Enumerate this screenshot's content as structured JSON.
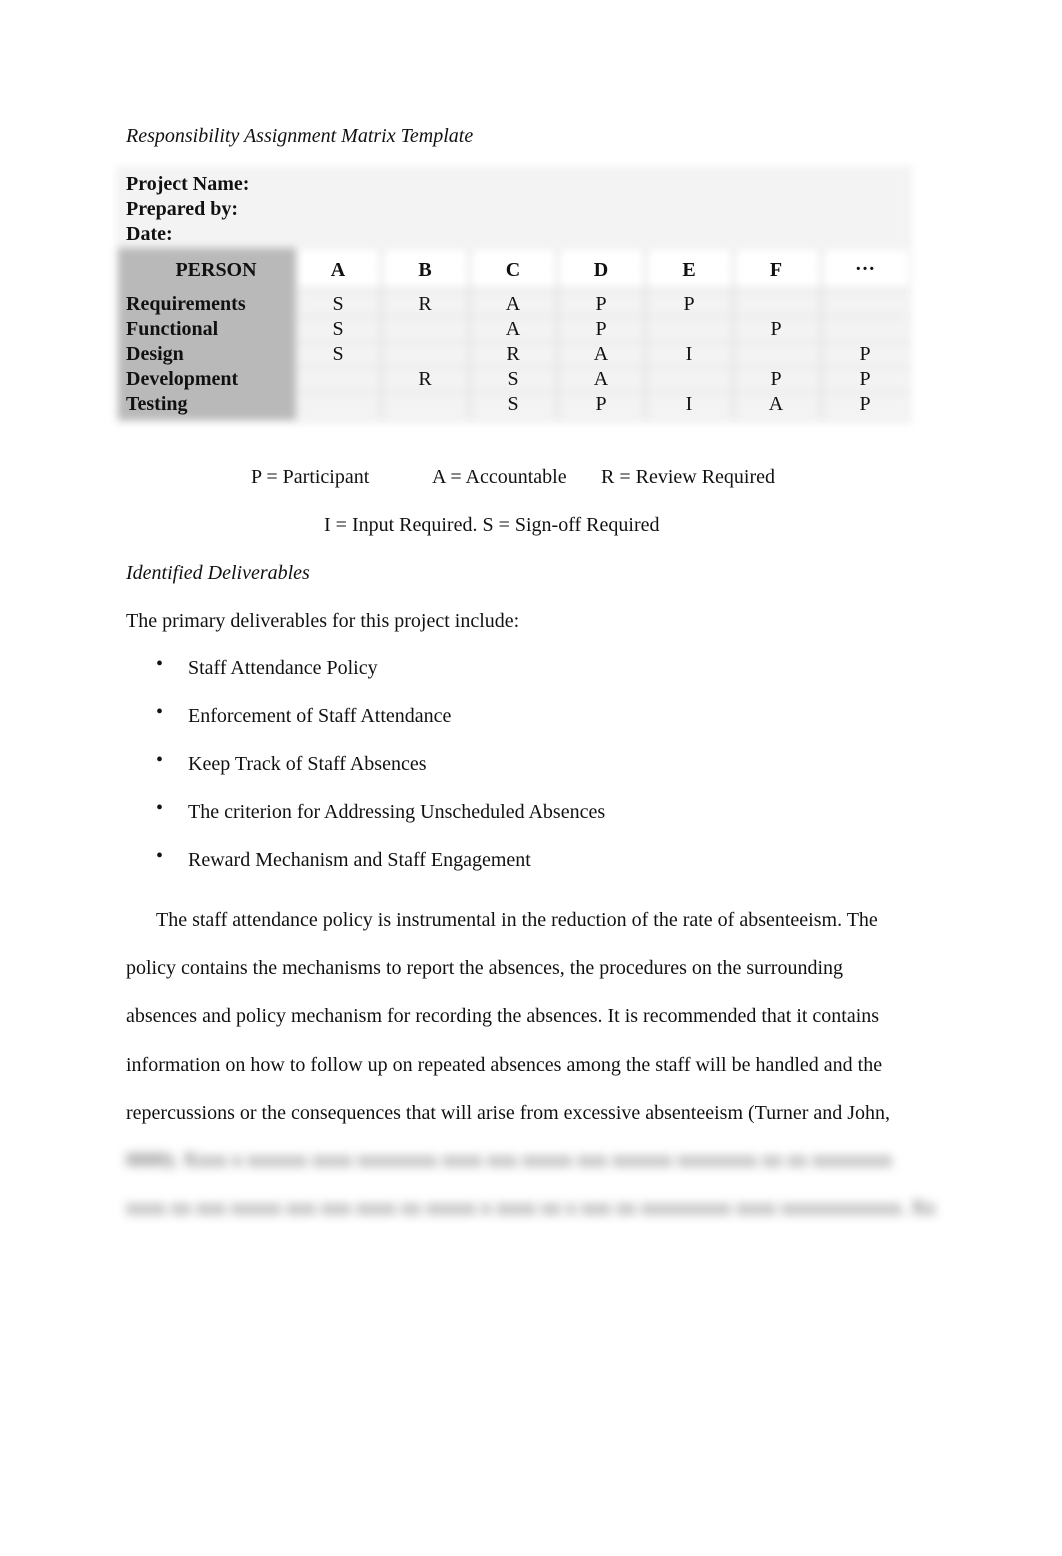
{
  "document": {
    "title": "Responsibility Assignment Matrix Template"
  },
  "matrix": {
    "meta": [
      {
        "label": "Project Name:",
        "value": ""
      },
      {
        "label": "Prepared by:",
        "value": ""
      },
      {
        "label": "Date:",
        "value": ""
      }
    ],
    "corner_label": "PERSON",
    "columns": [
      "A",
      "B",
      "C",
      "D",
      "E",
      "F",
      "…"
    ],
    "rows": [
      {
        "label": "Requirements",
        "cells": [
          "S",
          "R",
          "A",
          "P",
          "P",
          "",
          ""
        ]
      },
      {
        "label": "Functional",
        "cells": [
          "S",
          "",
          "A",
          "P",
          "",
          "P",
          ""
        ]
      },
      {
        "label": "Design",
        "cells": [
          "S",
          "",
          "R",
          "A",
          "I",
          "",
          "P"
        ]
      },
      {
        "label": "Development",
        "cells": [
          "",
          "R",
          "S",
          "A",
          "",
          "P",
          "P"
        ]
      },
      {
        "label": "Testing",
        "cells": [
          "",
          "",
          "S",
          "P",
          "I",
          "A",
          "P"
        ]
      }
    ]
  },
  "legend": {
    "participant": "P = Participant",
    "accountable": "A = Accountable",
    "review": "R = Review Required",
    "line2": "I = Input Required. S = Sign-off Required"
  },
  "deliverables": {
    "heading": "Identified Deliverables",
    "intro": "The primary deliverables for this project include:",
    "bullet_glyph": "•",
    "items": [
      "Staff Attendance Policy",
      "Enforcement of Staff Attendance",
      "Keep Track of Staff Absences",
      "The criterion for Addressing Unscheduled Absences",
      "Reward Mechanism and Staff Engagement"
    ]
  },
  "body": {
    "paragraph_lines": [
      "The staff attendance policy is instrumental in the reduction of the rate of absenteeism. The",
      "policy contains the mechanisms to report the absences, the procedures on the surrounding",
      "absences and policy mechanism for recording the absences. It is recommended that it contains",
      "information on how to follow up on repeated absences among the staff will be handled and the",
      "repercussions or the consequences that will arise from excessive absenteeism (Turner and John,"
    ],
    "blurred_lines": [
      "0000). Xxxx x xxxxxx xxxx xxxxxxxx xxxx xxx xxxxx xxx xxxxxx xxxxxxxx xx xx xxxxxxxx",
      "xxxx xx xxx xxxxx xxx xxx xxxx xx xxxxx x xxxx xx x xxx xx xxxxxxxxx xxxx xxxxxxxxxxxx. Xx"
    ]
  }
}
